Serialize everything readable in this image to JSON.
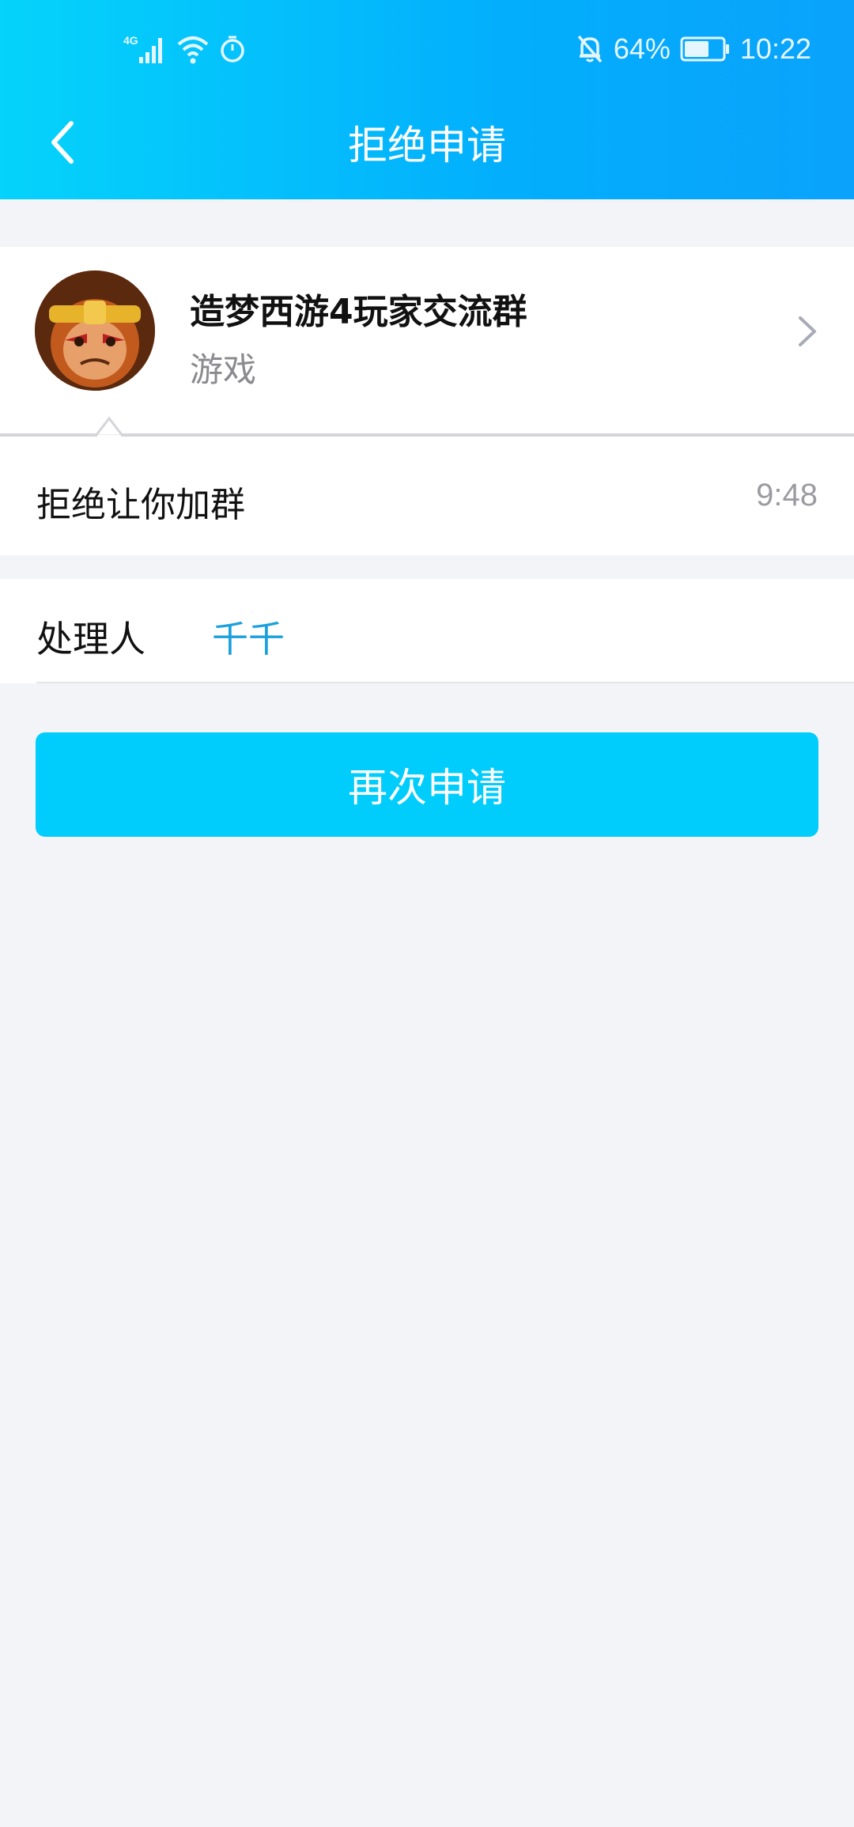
{
  "status_bar": {
    "network": "4G",
    "battery": "64%",
    "time": "10:22"
  },
  "nav": {
    "title": "拒绝申请",
    "back_icon": "chevron-left-icon"
  },
  "group": {
    "name": "造梦西游4玩家交流群",
    "category": "游戏",
    "avatar": "monkey-king-avatar"
  },
  "message": {
    "text": "拒绝让你加群",
    "time": "9:48"
  },
  "handler": {
    "label": "处理人",
    "name": "千千"
  },
  "actions": {
    "reapply_label": "再次申请"
  },
  "colors": {
    "header_gradient_start": "#05d3fb",
    "header_gradient_end": "#0aa2fb",
    "button": "#00cdfc",
    "link": "#1aa0dc",
    "background": "#f3f4f8"
  }
}
